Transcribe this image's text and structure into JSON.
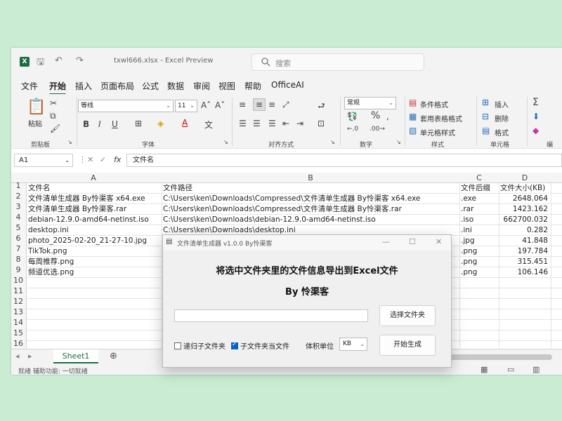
{
  "excel": {
    "app_icon": "excel-icon",
    "title": "txwl666.xlsx  -  Excel Preview",
    "search_placeholder": "搜索",
    "menu": [
      "文件",
      "开始",
      "插入",
      "页面布局",
      "公式",
      "数据",
      "审阅",
      "视图",
      "帮助",
      "OfficeAI"
    ],
    "ribbon": {
      "clipboard": {
        "paste": "粘贴",
        "group": "剪贴板"
      },
      "font": {
        "name": "等线",
        "size": "11",
        "group": "字体",
        "bold": "B",
        "italic": "I",
        "underline": "U"
      },
      "alignment": {
        "group": "对齐方式"
      },
      "number": {
        "format": "常规",
        "group": "数字",
        "percent": "%"
      },
      "styles": {
        "conditional": "条件格式",
        "table": "套用表格格式",
        "cell": "单元格样式",
        "group": "样式"
      },
      "cells": {
        "insert": "插入",
        "delete": "删除",
        "format": "格式",
        "group": "单元格"
      },
      "editing": {
        "group": "编"
      }
    },
    "name_box": "A1",
    "formula": "文件名",
    "columns": [
      "A",
      "B",
      "C",
      "D"
    ],
    "rows": [
      [
        "文件名",
        "文件路径",
        "文件后缀",
        "文件大小(KB)"
      ],
      [
        "文件清单生成器 By怜渠客 x64.exe",
        "C:\\Users\\ken\\Downloads\\Compressed\\文件清单生成器 By怜渠客 x64.exe",
        ".exe",
        "2648.064"
      ],
      [
        "文件清单生成器 By怜渠客.rar",
        "C:\\Users\\ken\\Downloads\\Compressed\\文件清单生成器 By怜渠客.rar",
        ".rar",
        "1423.162"
      ],
      [
        "debian-12.9.0-amd64-netinst.iso",
        "C:\\Users\\ken\\Downloads\\debian-12.9.0-amd64-netinst.iso",
        ".iso",
        "662700.032"
      ],
      [
        "desktop.ini",
        "C:\\Users\\ken\\Downloads\\desktop.ini",
        ".ini",
        "0.282"
      ],
      [
        "photo_2025-02-20_21-27-10.jpg",
        "",
        ".jpg",
        "41.848"
      ],
      [
        "TikTok.png",
        "",
        ".png",
        "197.784"
      ],
      [
        "每周推荐.png",
        "",
        ".png",
        "315.451"
      ],
      [
        "频道优选.png",
        "",
        ".png",
        "106.146"
      ]
    ],
    "row_numbers": [
      "1",
      "2",
      "3",
      "4",
      "5",
      "6",
      "7",
      "8",
      "9",
      "10",
      "11",
      "12",
      "13",
      "14",
      "15",
      "16"
    ],
    "sheet_tab": "Sheet1",
    "status": "就绪    辅助功能: 一切就绪"
  },
  "dialog": {
    "title": "文件清单生成器 v1.0.0 By怜渠客",
    "heading": "将选中文件夹里的文件信息导出到Excel文件",
    "byline": "By 怜渠客",
    "path_value": "",
    "choose_folder": "选择文件夹",
    "recursive_label": "递归子文件夹",
    "recursive_checked": false,
    "subfolder_label": "子文件夹当文件",
    "subfolder_checked": true,
    "unit_label": "体积单位",
    "unit_value": "KB",
    "start_button": "开始生成"
  }
}
